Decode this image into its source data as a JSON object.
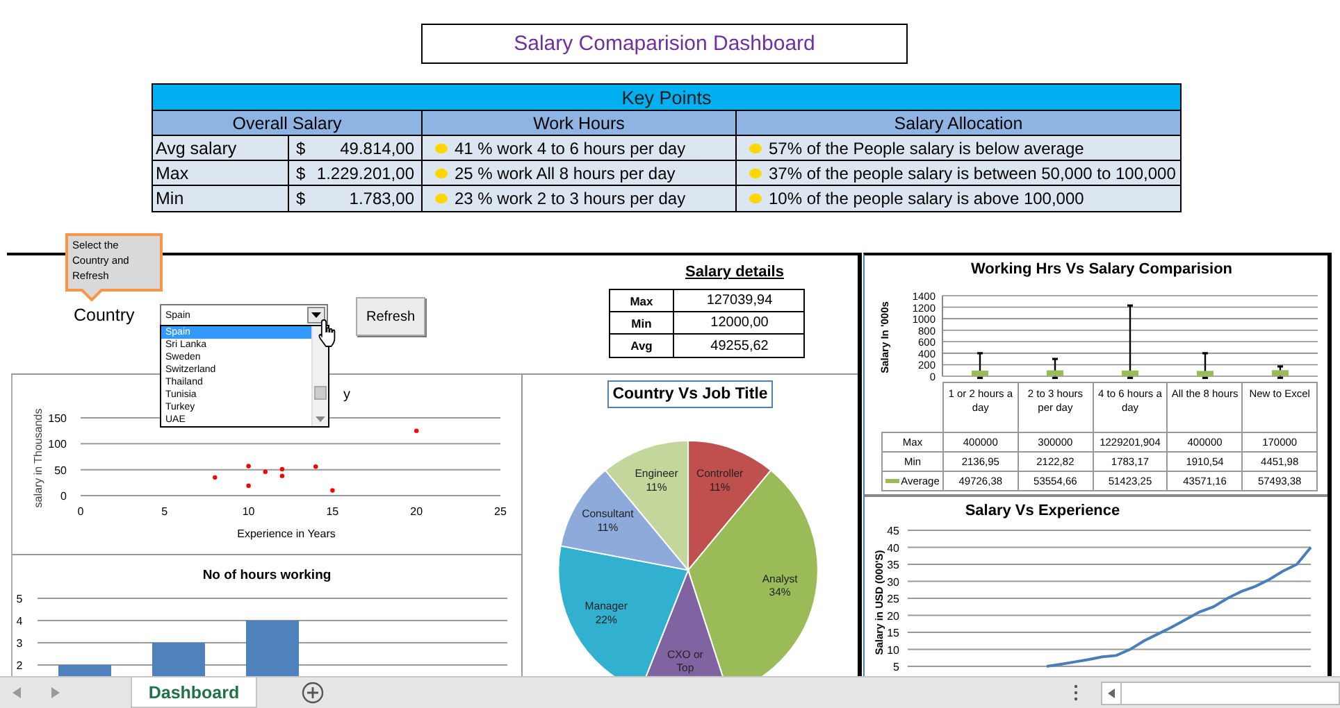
{
  "title": "Salary Comaparision Dashboard",
  "key_points": {
    "title": "Key Points",
    "columns": [
      "Overall Salary",
      "Work Hours",
      "Salary Allocation"
    ],
    "rows": [
      {
        "label": "Avg salary",
        "currency": "$",
        "amount": "49.814,00",
        "work_hours": "41 % work 4 to 6 hours per day",
        "allocation": "57% of the People salary is below average"
      },
      {
        "label": "Max",
        "currency": "$",
        "amount": "1.229.201,00",
        "work_hours": "25 % work All 8 hours per day",
        "allocation": "37% of the people salary is between 50,000 to 100,000"
      },
      {
        "label": "Min",
        "currency": "$",
        "amount": "1.783,00",
        "work_hours": "23 % work 2 to 3 hours per day",
        "allocation": "10% of the people salary is above 100,000"
      }
    ]
  },
  "callout": "Select the Country and Refresh",
  "country_picker": {
    "label": "Country",
    "value": "Spain",
    "expanded": true,
    "options": [
      {
        "label": "Spain",
        "selected": true
      },
      {
        "label": "Sri Lanka",
        "selected": false
      },
      {
        "label": "Sweden",
        "selected": false
      },
      {
        "label": "Switzerland",
        "selected": false
      },
      {
        "label": "Thailand",
        "selected": false
      },
      {
        "label": "Tunisia",
        "selected": false
      },
      {
        "label": "Turkey",
        "selected": false
      },
      {
        "label": "UAE",
        "selected": false
      }
    ]
  },
  "refresh_button": "Refresh",
  "salary_details": {
    "title": "Salary details",
    "rows": [
      {
        "label": "Max",
        "value": "127039,94"
      },
      {
        "label": "Min",
        "value": "12000,00"
      },
      {
        "label": "Avg",
        "value": "49255,62"
      }
    ]
  },
  "experience_chart": {
    "chart_data": {
      "type": "scatter",
      "title": "y",
      "xlabel": "Experience in Years",
      "ylabel": "salary in  Thousands",
      "x": [
        8,
        10,
        10,
        11,
        12,
        12,
        14,
        15,
        20
      ],
      "series": [
        {
          "color": "#ff0000",
          "values": [
            35,
            57,
            19,
            46,
            51,
            38,
            56,
            10,
            125
          ]
        }
      ],
      "xlim": [
        0,
        25
      ],
      "ylim": [
        0,
        150
      ],
      "xticks": [
        0,
        5,
        10,
        15,
        20,
        25
      ],
      "yticks": [
        0,
        50,
        100,
        150
      ],
      "grid": true
    }
  },
  "hours_chart": {
    "chart_data": {
      "type": "bar",
      "title": "No of hours working",
      "series": [
        {
          "color": "#4f81bd",
          "values": [
            2,
            3,
            4
          ]
        }
      ],
      "ylim": [
        0,
        5
      ],
      "yticks": [
        2,
        3,
        4,
        5
      ],
      "grid": true
    }
  },
  "job_chart": {
    "chart_data": {
      "type": "pie",
      "title": "Country Vs Job Title",
      "categories": [
        "Controller",
        "Analyst",
        "CXO or Top",
        "Manager",
        "Consultant",
        "Engineer"
      ],
      "values": [
        11,
        34,
        11,
        22,
        11,
        11
      ],
      "colors": [
        "#c0504d",
        "#9bbb59",
        "#8064a2",
        "#31b0cf",
        "#8eaadb",
        "#c3d69b"
      ],
      "data_labels": true,
      "value_labels": [
        "11%",
        "34%",
        null,
        "22%",
        "11%",
        "11%"
      ]
    }
  },
  "hours_salary_chart": {
    "chart_data": {
      "type": "scatter",
      "title": "Working Hrs Vs Salary Comparision",
      "ylabel": "Salary In '000s",
      "ylim": [
        0,
        1400
      ],
      "yticks": [
        0,
        200,
        400,
        600,
        800,
        1000,
        1200,
        1400
      ],
      "grid": true,
      "series": [
        {
          "name": "Max",
          "color": "#000000",
          "values": [
            400,
            300,
            1229,
            400,
            170
          ]
        },
        {
          "name": "Min",
          "color": "#000000",
          "values": [
            2,
            2,
            2,
            2,
            4
          ]
        },
        {
          "name": "Average",
          "color": "#9bbb59",
          "values": [
            50,
            54,
            51,
            44,
            57
          ]
        }
      ]
    },
    "table_columns": [
      "1 or 2 hours a day",
      "2 to 3 hours per day",
      "4 to 6 hours a day",
      "All the 8 hours",
      "New to Excel"
    ],
    "data_table": [
      [
        "400000",
        "300000",
        "1229201,904",
        "400000",
        "170000"
      ],
      [
        "2136,95",
        "2122,82",
        "1783,17",
        "1910,54",
        "4451,98"
      ],
      [
        "49726,38",
        "53554,66",
        "51423,25",
        "43571,16",
        "57493,38"
      ]
    ]
  },
  "salary_experience_chart": {
    "chart_data": {
      "type": "line",
      "title": "Salary Vs Experience",
      "ylabel": "Salary in USD (000'S)",
      "ylim": [
        5,
        45
      ],
      "yticks": [
        5,
        10,
        15,
        20,
        25,
        30,
        35,
        40,
        45
      ],
      "grid": true,
      "series": [
        {
          "color": "#4a7ebb",
          "values": [
            null,
            null,
            null,
            null,
            null,
            null,
            null,
            null,
            null,
            null,
            5,
            5.6,
            6.3,
            7,
            7.8,
            8.2,
            10,
            12.5,
            14.5,
            16.5,
            18.8,
            21,
            22.5,
            25,
            27,
            28.5,
            30.5,
            33,
            35,
            40
          ]
        }
      ]
    }
  },
  "sheet_tabs": [
    {
      "label": "Dashboard",
      "selected": true
    }
  ]
}
